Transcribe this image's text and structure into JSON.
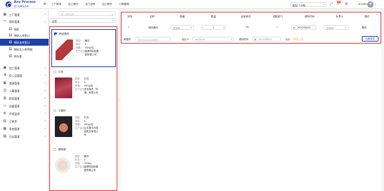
{
  "app": {
    "logo_title": "Any Process",
    "logo_subtitle": "轻工业解决方案"
  },
  "topnav": [
    "工厂概况",
    "加工概况",
    "加工台账",
    "加工概况",
    "订单管理"
  ],
  "header": {
    "org_select": "食品厂(示例)",
    "badge_count": "3",
    "username": "anyfarm"
  },
  "sidebar": {
    "items": [
      {
        "icon": "factory-icon",
        "label": "工厂管理",
        "arrow": "▾"
      },
      {
        "icon": "scissors-icon",
        "label": "原料管理",
        "arrow": "▴"
      },
      {
        "icon": "document-icon",
        "label": "原料",
        "sub": true
      },
      {
        "icon": "document-icon",
        "label": "原料入库登记",
        "sub": true
      },
      {
        "icon": "document-icon",
        "label": "原料出库登记",
        "sub": true,
        "active": true
      },
      {
        "icon": "document-icon",
        "label": "原料出入库明细",
        "sub": true
      },
      {
        "icon": "document-icon",
        "label": "库存查",
        "sub": true
      },
      {
        "icon": "box-icon",
        "label": "加工管理",
        "arrow": "▾"
      },
      {
        "icon": "flask-icon",
        "label": "投入品管理",
        "arrow": "▾"
      },
      {
        "icon": "grid-icon",
        "label": "溯源管理",
        "arrow": "▾"
      },
      {
        "icon": "person-icon",
        "label": "人事管理",
        "arrow": "▾"
      },
      {
        "icon": "chart-icon",
        "label": "财务管理",
        "arrow": "▾"
      },
      {
        "icon": "monitor-icon",
        "label": "设备管理",
        "arrow": "▾"
      },
      {
        "icon": "gear-icon",
        "label": "环境监测",
        "arrow": "▾"
      },
      {
        "icon": "document-icon",
        "label": "订单库",
        "arrow": "▾"
      },
      {
        "icon": "grid-icon",
        "label": "系统管理",
        "arrow": "▾"
      },
      {
        "icon": "calendar-icon",
        "label": "日志管理",
        "arrow": "▾"
      }
    ]
  },
  "products": {
    "search_placeholder": "输入原料名称",
    "category": "全部",
    "labels": {
      "type": "类型:",
      "stock": "库存:",
      "spec": "规格:",
      "origin": "生产企业:"
    },
    "items": [
      {
        "name": "精品猪肉",
        "type": "猪肉",
        "stock": "0",
        "spec": "10kg/包",
        "origin": "金牌肉制品集团有限公司",
        "selected": true,
        "img": "meat"
      },
      {
        "name": "牛肉",
        "type": "牛肉",
        "stock": "0",
        "spec": "500g/包",
        "origin": "亚农食品（华通）有限公司",
        "img": "beef"
      },
      {
        "name": "牛腿肉",
        "type": "牛肉",
        "stock": "0",
        "spec": "500g/包",
        "origin": "山东国大肉食品联合有限公司",
        "img": "cut"
      },
      {
        "name": "猪前腿",
        "type": "猪肉",
        "stock": "0",
        "spec": "100kg",
        "origin": "金牌肉制品集团有限公司",
        "img": "pork"
      }
    ]
  },
  "table": {
    "headers": [
      "序号",
      "名称",
      "规格",
      "数量",
      "出库单位",
      "领取部门",
      "领料时间",
      "负责人",
      "操作"
    ],
    "row": {
      "index": "1",
      "name": "精品猪肉",
      "spec_placeholder": "请选择",
      "qty_minus": "-",
      "qty": "1",
      "qty_plus": "+",
      "unit": "kg",
      "date": "2020/06/01",
      "owner_placeholder": "请选择",
      "action": "删除"
    }
  },
  "footer": {
    "note_label": "单据号",
    "note_placeholder": "系统自动生成单据号",
    "handler_label": "经办人",
    "handler_value": "anyfarm",
    "time_label": "领料时间",
    "time_value": "2020/06/01",
    "total_label": "合计",
    "total_amount": "1件投入品",
    "save_button": "出库保存"
  }
}
